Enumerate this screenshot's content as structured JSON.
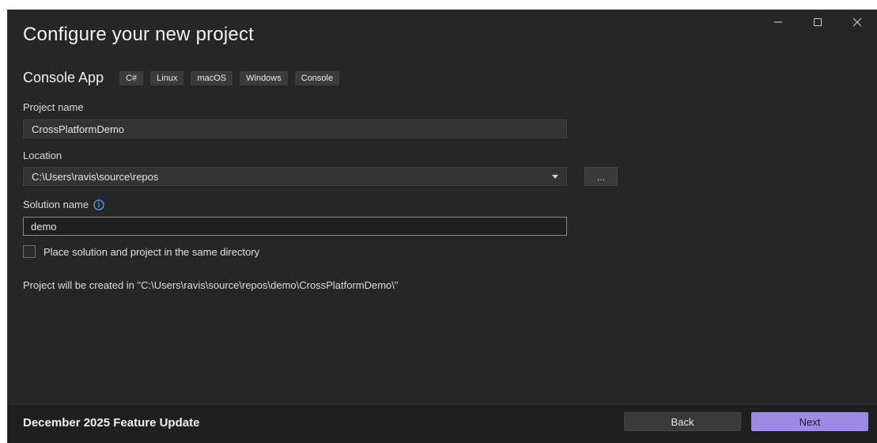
{
  "window": {
    "title": "Configure your new project"
  },
  "template": {
    "name": "Console App",
    "tags": [
      "C#",
      "Linux",
      "macOS",
      "Windows",
      "Console"
    ]
  },
  "form": {
    "project_name_label": "Project name",
    "project_name_value": "CrossPlatformDemo",
    "location_label": "Location",
    "location_value": "C:\\Users\\ravis\\source\\repos",
    "browse_label": "...",
    "solution_name_label": "Solution name",
    "solution_name_value": "demo",
    "same_dir_label": "Place solution and project in the same directory",
    "path_info": "Project will be created in \"C:\\Users\\ravis\\source\\repos\\demo\\CrossPlatformDemo\\\""
  },
  "footer": {
    "feature_update": "December 2025 Feature Update",
    "back_label": "Back",
    "next_label": "Next"
  },
  "icons": {
    "minimize": "minimize-icon",
    "maximize": "maximize-icon",
    "close": "close-icon",
    "info": "info-icon",
    "dropdown": "chevron-down-icon"
  },
  "colors": {
    "accent": "#9b8ae6",
    "info": "#4aa3ff",
    "background": "#262626",
    "footer": "#1f1f1f"
  }
}
